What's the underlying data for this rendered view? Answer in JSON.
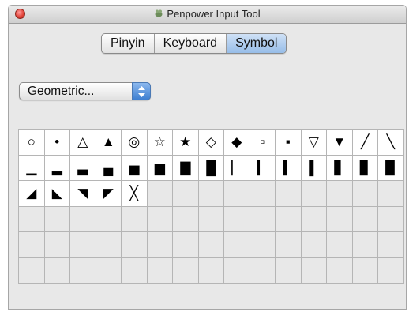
{
  "window": {
    "title": "Penpower Input Tool"
  },
  "tabs": [
    {
      "label": "Pinyin",
      "active": false
    },
    {
      "label": "Keyboard",
      "active": false
    },
    {
      "label": "Symbol",
      "active": true
    }
  ],
  "category_select": {
    "value": "Geometric..."
  },
  "symbols": [
    {
      "name": "white-circle-small-symbol",
      "text": "○"
    },
    {
      "name": "black-circle-small-symbol",
      "text": "•"
    },
    {
      "name": "white-up-triangle-symbol",
      "text": "△"
    },
    {
      "name": "black-up-triangle-symbol",
      "text": "▲"
    },
    {
      "name": "bullseye-symbol",
      "text": "◎"
    },
    {
      "name": "white-star-symbol",
      "text": "☆"
    },
    {
      "name": "black-star-symbol",
      "text": "★"
    },
    {
      "name": "white-diamond-symbol",
      "text": "◇"
    },
    {
      "name": "black-diamond-symbol",
      "text": "◆"
    },
    {
      "name": "white-small-square-symbol",
      "text": "▫"
    },
    {
      "name": "black-small-square-symbol",
      "text": "▪"
    },
    {
      "name": "white-down-triangle-symbol",
      "text": "▽"
    },
    {
      "name": "black-down-triangle-symbol",
      "text": "▼"
    },
    {
      "name": "diagonal-rising-symbol",
      "text": "╱"
    },
    {
      "name": "diagonal-falling-symbol",
      "text": "╲"
    },
    {
      "name": "lower-eighth-block-symbol",
      "text": "▁"
    },
    {
      "name": "lower-quarter-block-symbol",
      "text": "▂"
    },
    {
      "name": "lower-three-eighths-block-symbol",
      "text": "▃"
    },
    {
      "name": "lower-half-block-symbol",
      "text": "▄"
    },
    {
      "name": "lower-five-eighths-block-symbol",
      "text": "▅"
    },
    {
      "name": "lower-three-quarters-block-symbol",
      "text": "▆"
    },
    {
      "name": "lower-seven-eighths-block-symbol",
      "text": "▇"
    },
    {
      "name": "full-block-symbol",
      "text": "█"
    },
    {
      "name": "left-one-eighth-block-symbol",
      "text": "▏"
    },
    {
      "name": "left-one-quarter-block-symbol",
      "text": "▎"
    },
    {
      "name": "left-three-eighths-block-symbol",
      "text": "▍"
    },
    {
      "name": "left-half-block-symbol",
      "text": "▌"
    },
    {
      "name": "left-five-eighths-block-symbol",
      "text": "▋"
    },
    {
      "name": "left-three-quarters-block-symbol",
      "text": "▊"
    },
    {
      "name": "left-seven-eighths-block-symbol",
      "text": "▉"
    },
    {
      "name": "lower-right-triangle-symbol",
      "text": "◢"
    },
    {
      "name": "lower-left-triangle-symbol",
      "text": "◣"
    },
    {
      "name": "upper-right-triangle-symbol",
      "text": "◥"
    },
    {
      "name": "upper-left-triangle-symbol",
      "text": "◤"
    },
    {
      "name": "diagonal-cross-symbol",
      "text": "╳"
    }
  ],
  "grid": {
    "columns": 15,
    "rows": 6
  }
}
